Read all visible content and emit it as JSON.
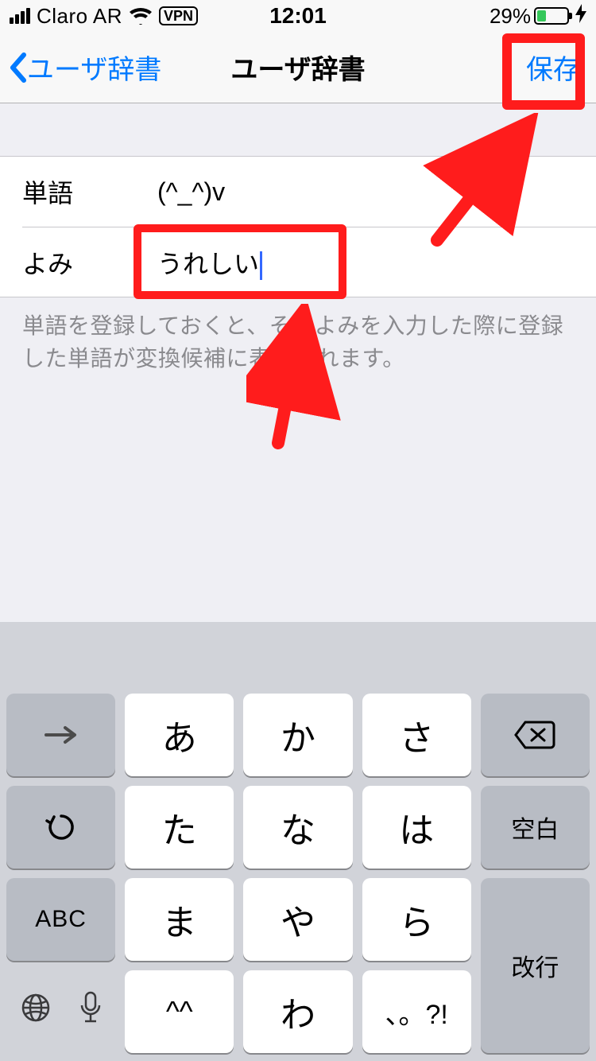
{
  "status": {
    "carrier": "Claro AR",
    "vpn": "VPN",
    "time": "12:01",
    "battery_pct": "29%"
  },
  "nav": {
    "back_label": "ユーザ辞書",
    "title": "ユーザ辞書",
    "save_label": "保存"
  },
  "form": {
    "word_label": "単語",
    "word_value": "(^_^)v",
    "yomi_label": "よみ",
    "yomi_value": "うれしい"
  },
  "footer": "単語を登録しておくと、そのよみを入力した際に登録した単語が変換候補に表示されます。",
  "keyboard": {
    "rows": [
      [
        "→",
        "あ",
        "か",
        "さ",
        "⌫"
      ],
      [
        "↺",
        "た",
        "な",
        "は",
        "空白"
      ],
      [
        "ABC",
        "ま",
        "や",
        "ら",
        "改行"
      ],
      [
        "🌐/🎤",
        "^^",
        "わ",
        "、。?!",
        ""
      ]
    ],
    "keys": {
      "r1c1": "→",
      "r1c2": "あ",
      "r1c3": "か",
      "r1c4": "さ",
      "r2c1": "↺",
      "r2c2": "た",
      "r2c3": "な",
      "r2c4": "は",
      "r2c5": "空白",
      "r3c1": "ABC",
      "r3c2": "ま",
      "r3c3": "や",
      "r3c4": "ら",
      "r3c5": "改行",
      "r4c2": "^^",
      "r4c3": "わ",
      "r4c4": "、。?!"
    }
  }
}
